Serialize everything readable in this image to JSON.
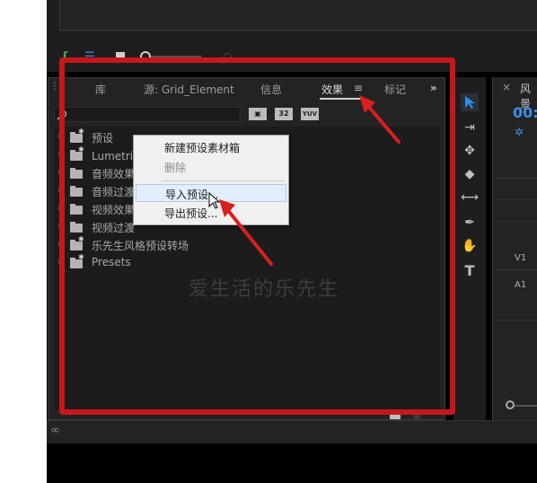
{
  "colors": {
    "accent": "#2d8ceb",
    "highlight_red": "#c8161c",
    "panel_bg": "#232323",
    "menu_bg": "#f0f0f0"
  },
  "effects_panel": {
    "menu_icon": "hamburger-menu-icon",
    "tabs": [
      {
        "label": "库"
      },
      {
        "label": "源: Grid_Element"
      },
      {
        "label": "信息"
      },
      {
        "label": "效果"
      },
      {
        "label": "标记"
      }
    ],
    "overflow_icon": "double-chevron-right-icon",
    "search_icon": "search-icon",
    "filter_buttons": [
      {
        "label": "",
        "icon": "accelerated-effects-icon"
      },
      {
        "label": "32",
        "icon": "32bit-effects-icon"
      },
      {
        "label": "YUV",
        "icon": "yuv-effects-icon"
      }
    ],
    "tree_items": [
      {
        "label": "预设",
        "icon": "star-folder-icon"
      },
      {
        "label": "Lumetri 预设",
        "icon": "star-folder-icon"
      },
      {
        "label": "音频效果",
        "icon": "folder-icon"
      },
      {
        "label": "音频过渡",
        "icon": "folder-icon"
      },
      {
        "label": "视频效果",
        "icon": "folder-icon"
      },
      {
        "label": "视频过渡",
        "icon": "folder-icon"
      },
      {
        "label": "乐先生风格预设转场",
        "icon": "star-folder-icon"
      },
      {
        "label": "Presets",
        "icon": "star-folder-icon"
      }
    ]
  },
  "context_menu": {
    "items": [
      {
        "label": "新建预设素材箱",
        "enabled": true
      },
      {
        "label": "删除",
        "enabled": false
      },
      {
        "label": "导入预设...",
        "enabled": true,
        "hovered": true
      },
      {
        "label": "导出预设...",
        "enabled": true
      }
    ]
  },
  "tools": [
    {
      "icon": "selection-tool-icon",
      "active": true
    },
    {
      "icon": "track-select-tool-icon"
    },
    {
      "icon": "ripple-edit-tool-icon"
    },
    {
      "icon": "razor-tool-icon"
    },
    {
      "icon": "slip-tool-icon"
    },
    {
      "icon": "pen-tool-icon"
    },
    {
      "icon": "hand-tool-icon"
    },
    {
      "icon": "type-tool-icon"
    }
  ],
  "right_panel": {
    "title": "风景",
    "timecode": "00:0",
    "tracks": [
      "V1",
      "A1"
    ]
  },
  "watermark": "爱生活的乐先生"
}
